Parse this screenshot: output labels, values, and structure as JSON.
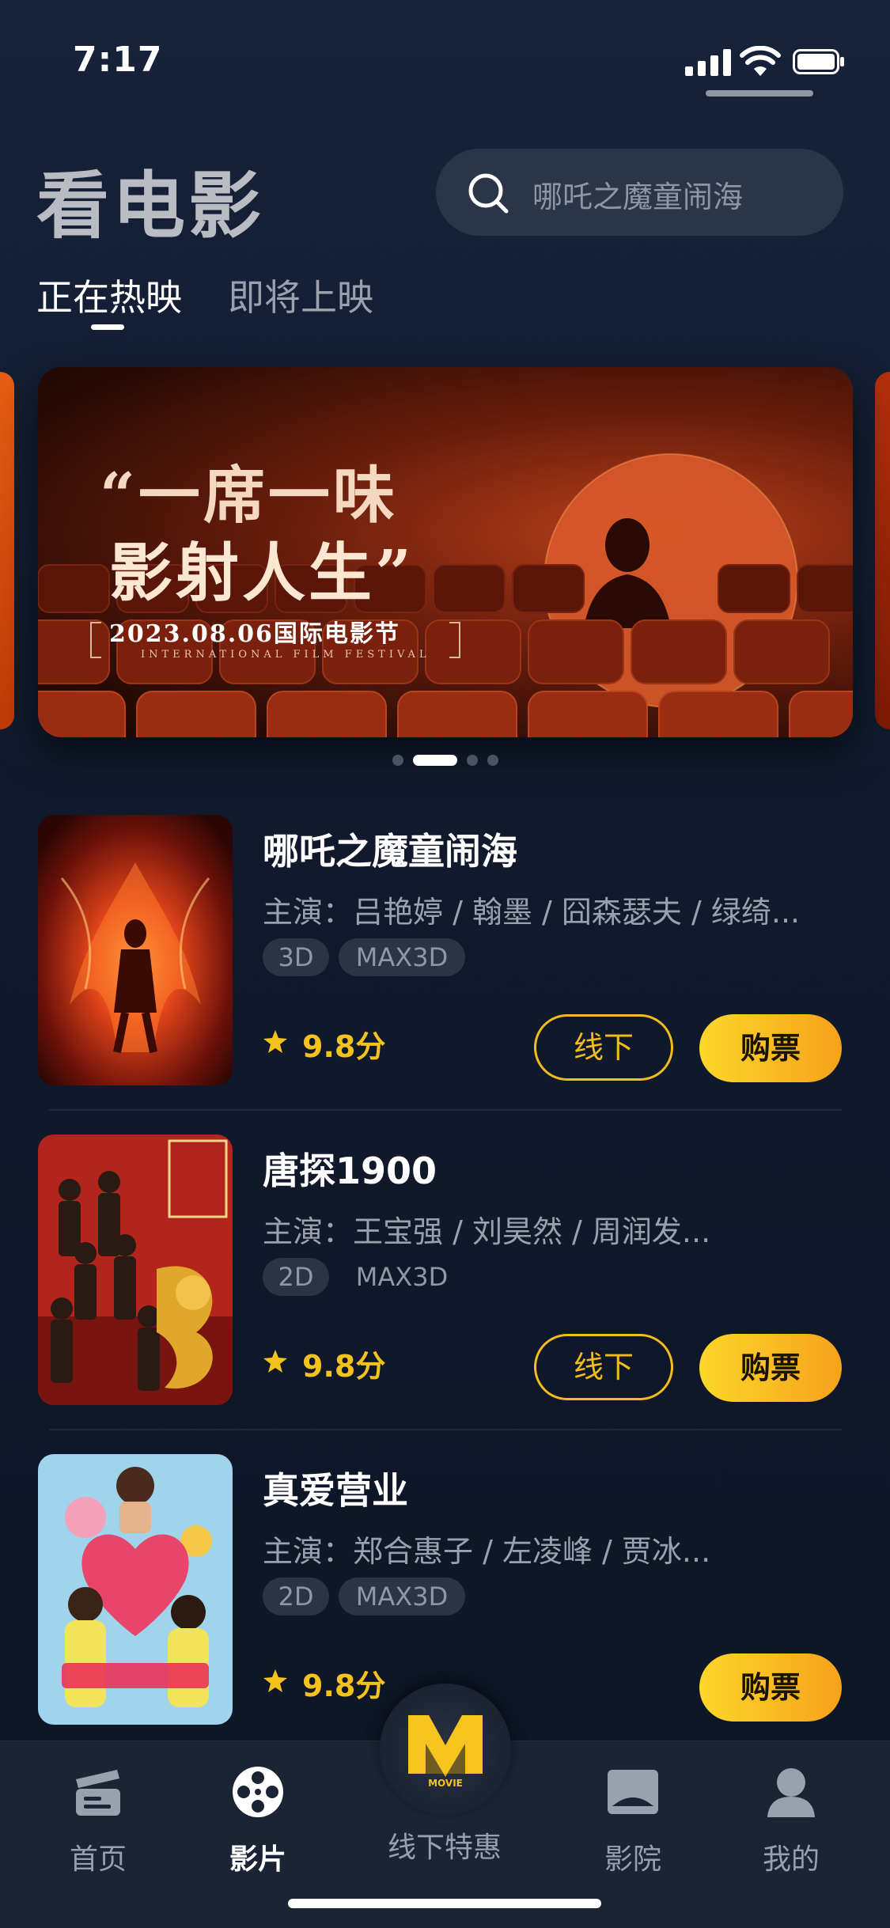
{
  "status_bar": {
    "time": "7:17"
  },
  "header": {
    "title": "看电影",
    "search_placeholder": "哪吒之魔童闹海"
  },
  "tabs": [
    {
      "label": "正在热映",
      "active": true
    },
    {
      "label": "即将上映",
      "active": false
    }
  ],
  "banner": {
    "line1": "“一席一味",
    "line2": "影射人生”",
    "date": "2023.08.06国际电影节",
    "subtitle": "INTERNATIONAL FILM FESTIVAL",
    "page_count": 4,
    "active_page": 2
  },
  "movies": [
    {
      "title": "哪吒之魔童闹海",
      "cast": "主演：吕艳婷 / 翰墨 / 囧森瑟夫 / 绿绮...",
      "tags": [
        "3D",
        "MAX3D"
      ],
      "rating": "9.8分",
      "offline_label": "线下",
      "buy_label": "购票"
    },
    {
      "title": "唐探1900",
      "cast": "主演：王宝强 / 刘昊然 / 周润发...",
      "tags": [
        "2D",
        "MAX3D"
      ],
      "rating": "9.8分",
      "offline_label": "线下",
      "buy_label": "购票"
    },
    {
      "title": "真爱营业",
      "cast": "主演：郑合惠子 / 左凌峰 / 贾冰...",
      "tags": [
        "2D",
        "MAX3D"
      ],
      "rating": "9.8分",
      "offline_label": "",
      "buy_label": "购票"
    }
  ],
  "tabbar": {
    "items": [
      {
        "label": "首页",
        "icon": "clapperboard-icon"
      },
      {
        "label": "影片",
        "icon": "film-reel-icon",
        "active": true
      },
      {
        "label": "影院",
        "icon": "cinema-screen-icon"
      },
      {
        "label": "我的",
        "icon": "user-icon"
      }
    ],
    "center_label": "线下特惠",
    "center_logo": "MOVIE"
  },
  "colors": {
    "accent": "#f2bc1b",
    "buy_gradient_start": "#fcd72a",
    "buy_gradient_end": "#f6a21a",
    "background": "#111a2d"
  }
}
